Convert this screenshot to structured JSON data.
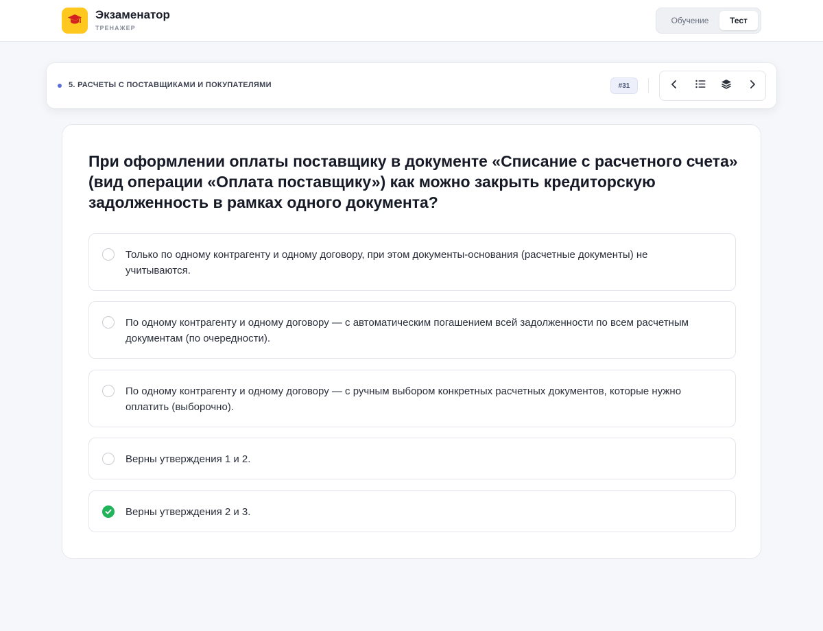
{
  "app": {
    "title": "Экзаменатор",
    "subtitle": "ТРЕНАЖЕР"
  },
  "modes": {
    "learn": "Обучение",
    "test": "Тест",
    "active": "test"
  },
  "section": {
    "title": "5. РАСЧЕТЫ С ПОСТАВЩИКАМИ И ПОКУПАТЕЛЯМИ",
    "question_badge": "#31"
  },
  "icons": {
    "logo": "graduation-cap-icon",
    "prev": "chevron-left-icon",
    "list": "list-icon",
    "layers": "layers-icon",
    "next": "chevron-right-icon",
    "selected": "check-circle-icon"
  },
  "colors": {
    "accent": "#ffc81e",
    "correct": "#22b45a",
    "dot": "#5b6fd6"
  },
  "question": {
    "text": "При оформлении оплаты поставщику в документе «Списание с расчетного счета» (вид операции «Оплата поставщику») как можно закрыть кредиторскую задолженность в рамках одного документа?"
  },
  "options": [
    {
      "text": "Только по одному контрагенту и одному договору, при этом документы-основания (расчетные документы) не учитываются.",
      "selected": false
    },
    {
      "text": "По одному контрагенту и одному договору — с автоматическим погашением всей задолженности по всем расчетным документам (по очередности).",
      "selected": false
    },
    {
      "text": "По одному контрагенту и одному договору — с ручным выбором конкретных расчетных документов, которые нужно оплатить (выборочно).",
      "selected": false
    },
    {
      "text": "Верны утверждения 1 и 2.",
      "selected": false
    },
    {
      "text": "Верны утверждения 2 и 3.",
      "selected": true
    }
  ]
}
